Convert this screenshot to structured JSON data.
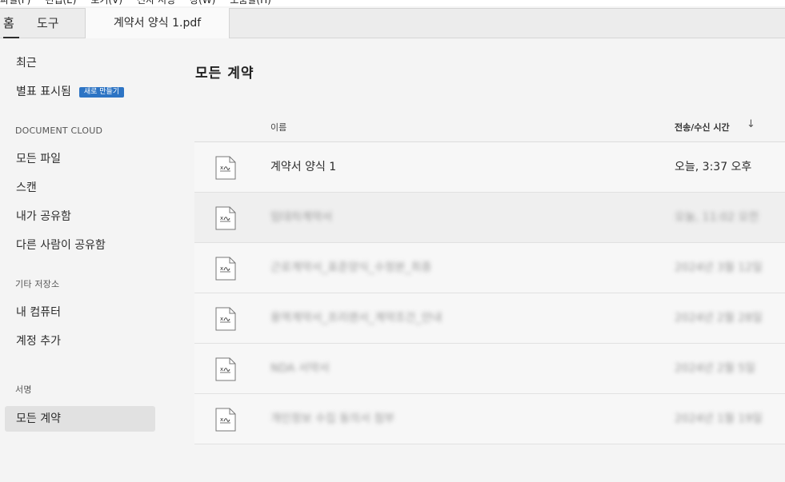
{
  "menu": {
    "items": [
      "파일(F)",
      "편집(E)",
      "보기(V)",
      "전자 서명",
      "창(W)",
      "도움말(H)"
    ]
  },
  "tabs": {
    "home": "홈",
    "tools": "도구",
    "document": "계약서 양식 1.pdf"
  },
  "sidebar": {
    "recent": "최근",
    "starred": "별표 표시됨",
    "new_badge": "새로 만들기",
    "document_cloud_header": "DOCUMENT CLOUD",
    "all_files": "모든 파일",
    "scan": "스캔",
    "shared_by_me": "내가 공유함",
    "shared_by_others": "다른 사람이 공유함",
    "other_storage_header": "기타 저장소",
    "my_computer": "내 컴퓨터",
    "add_account": "계정 추가",
    "sign_header": "서명",
    "all_agreements": "모든 계약"
  },
  "main": {
    "title": "모든 계약",
    "columns": {
      "name": "이름",
      "time": "전송/수신 시간"
    },
    "rows": [
      {
        "name": "계약서 양식 1",
        "time": "오늘, 3:37 오후"
      },
      {
        "name": "임대차계약서",
        "time": "오늘, 11:02 오전"
      },
      {
        "name": "근로계약서_표준양식_수정본_최종",
        "time": "2024년 3월 12일"
      },
      {
        "name": "용역계약서_프리랜서_계약조건_안내",
        "time": "2024년 2월 28일"
      },
      {
        "name": "NDA 서약서",
        "time": "2024년 2월 5일"
      },
      {
        "name": "개인정보 수집 동의서 첨부",
        "time": "2024년 1월 19일"
      }
    ]
  }
}
